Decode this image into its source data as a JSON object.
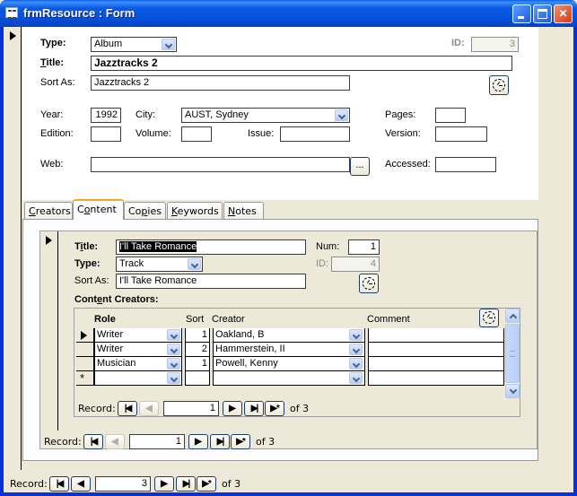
{
  "window": {
    "title": "frmResource : Form",
    "minimize_icon": "minimize-icon",
    "maximize_icon": "maximize-icon",
    "close_icon": "close-icon"
  },
  "main": {
    "type_label": "Type:",
    "type_value": "Album",
    "id_label": "ID:",
    "id_value": "3",
    "title_label_pre": "",
    "title_label_u": "T",
    "title_label_post": "itle:",
    "title_value": "Jazztracks 2",
    "sort_as_label": "Sort As:",
    "sort_as_value": "Jazztracks 2",
    "year_label": "Year:",
    "year_value": "1992",
    "city_label": "City:",
    "city_value": "AUST, Sydney",
    "pages_label": "Pages:",
    "pages_value": "",
    "edition_label": "Edition:",
    "edition_value": "",
    "volume_label": "Volume:",
    "volume_value": "",
    "issue_label": "Issue:",
    "issue_value": "",
    "version_label": "Version:",
    "version_value": "",
    "web_label": "Web:",
    "web_value": "",
    "browse_button": "...",
    "accessed_label": "Accessed:",
    "accessed_value": ""
  },
  "tabs": [
    {
      "label_u": "C",
      "label_rest": "reators",
      "active": false
    },
    {
      "label_pre": "C",
      "label_u": "o",
      "label_rest": "ntent",
      "active": true
    },
    {
      "label_pre": "Co",
      "label_u": "p",
      "label_rest": "ies",
      "active": false
    },
    {
      "label_u": "K",
      "label_rest": "eywords",
      "active": false
    },
    {
      "label_u": "N",
      "label_rest": "otes",
      "active": false
    }
  ],
  "content": {
    "title_label_pre": "T",
    "title_label_u": "i",
    "title_label_post": "tle:",
    "title_value": "I'll Take Romance",
    "num_label": "Num:",
    "num_value": "1",
    "type_label": "Type:",
    "type_value": "Track",
    "id_label": "ID:",
    "id_value": "4",
    "sort_as_label": "Sort As:",
    "sort_as_value": "I'll Take Romance",
    "creators_label_pre": "Cont",
    "creators_label_u": "e",
    "creators_label_post": "nt Creators:",
    "grid": {
      "columns": [
        "Role",
        "Sort",
        "Creator",
        "Comment"
      ],
      "rows": [
        {
          "role": "Writer",
          "sort": "1",
          "creator": "Oakland, B",
          "comment": "",
          "current": true
        },
        {
          "role": "Writer",
          "sort": "2",
          "creator": "Hammerstein, II",
          "comment": "",
          "current": false
        },
        {
          "role": "Musician",
          "sort": "1",
          "creator": "Powell, Kenny",
          "comment": "",
          "current": false
        }
      ],
      "new_row_marker": "*"
    },
    "grid_nav": {
      "label": "Record:",
      "current": "1",
      "of_text": "of 3"
    },
    "content_nav": {
      "label": "Record:",
      "current": "1",
      "of_text": "of 3"
    }
  },
  "main_nav": {
    "label": "Record:",
    "current": "3",
    "of_text": "of 3"
  }
}
